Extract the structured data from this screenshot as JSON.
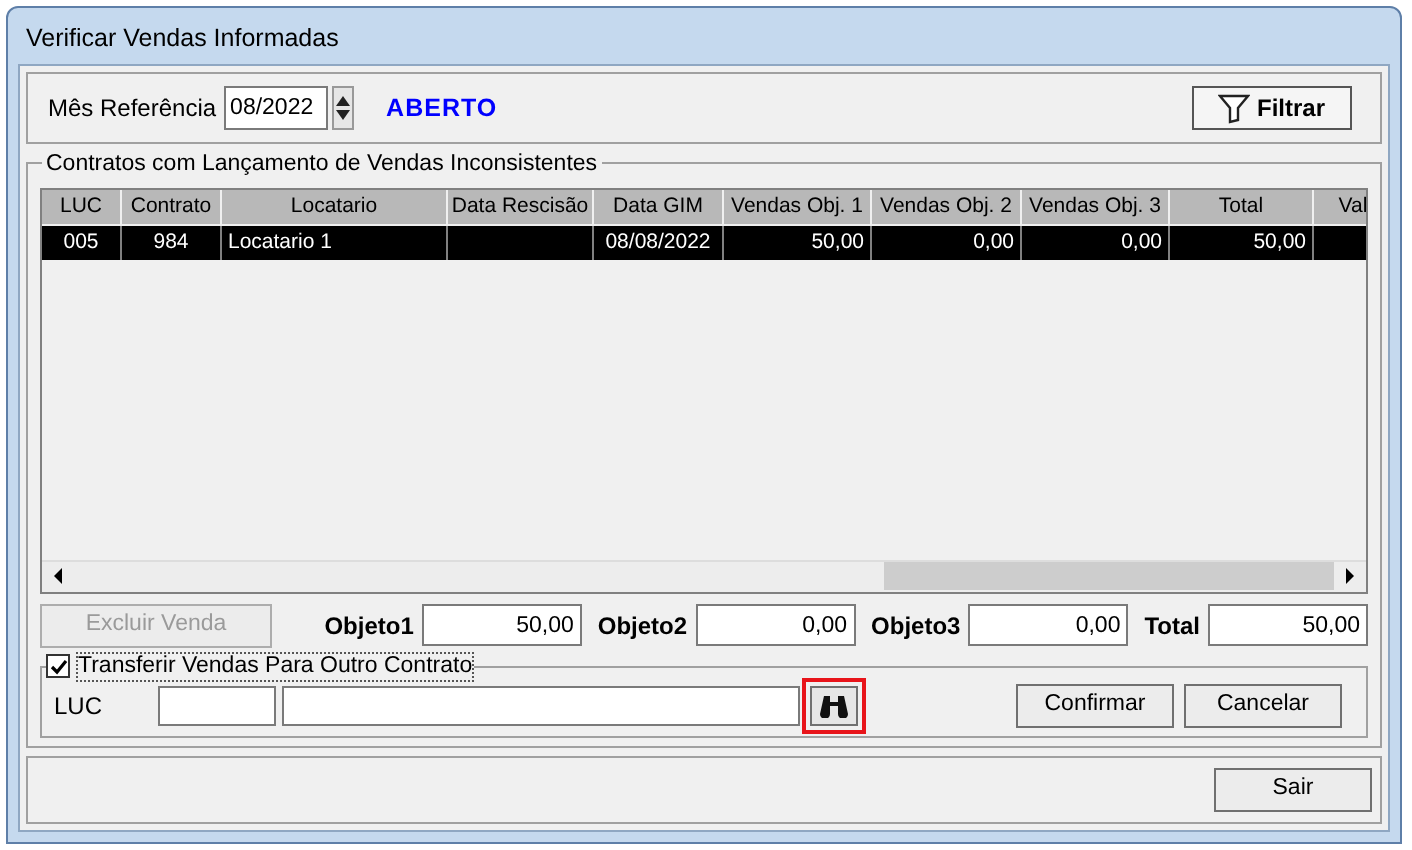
{
  "window": {
    "title": "Verificar Vendas Informadas"
  },
  "reference": {
    "label": "Mês Referência",
    "value": "08/2022",
    "status": "ABERTO"
  },
  "filter_button": "Filtrar",
  "group": {
    "title": "Contratos com Lançamento de Vendas Inconsistentes"
  },
  "table": {
    "columns": [
      "LUC",
      "Contrato",
      "Locatario",
      "Data Rescisão",
      "Data GIM",
      "Vendas Obj. 1",
      "Vendas Obj. 2",
      "Vendas Obj. 3",
      "Total",
      "Val"
    ],
    "rows": [
      {
        "selected": true,
        "cells": [
          "005",
          "984",
          "Locatario 1",
          "",
          "08/08/2022",
          "50,00",
          "0,00",
          "0,00",
          "50,00",
          ""
        ]
      }
    ]
  },
  "delete_button": {
    "label": "Excluir Venda",
    "disabled": true
  },
  "totals": [
    {
      "label": "Objeto1",
      "value": "50,00"
    },
    {
      "label": "Objeto2",
      "value": "0,00"
    },
    {
      "label": "Objeto3",
      "value": "0,00"
    },
    {
      "label": "Total",
      "value": "50,00"
    }
  ],
  "transfer": {
    "label": "Transferir Vendas Para Outro Contrato",
    "checked": true,
    "luc_label": "LUC",
    "search_highlighted": true
  },
  "buttons": [
    "Confirmar",
    "Cancelar"
  ],
  "exit_button": "Sair"
}
